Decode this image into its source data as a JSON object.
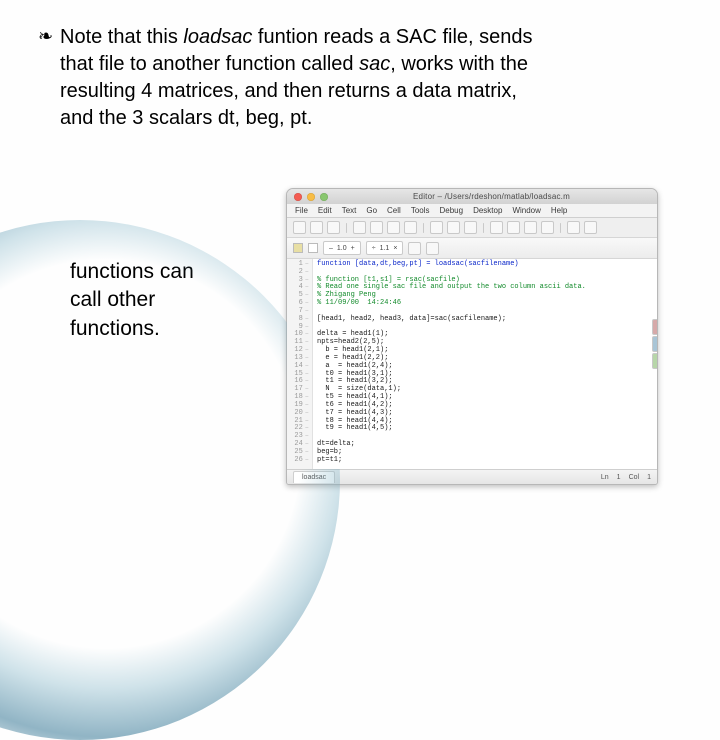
{
  "accent": "#3f7a93",
  "bullet": {
    "glyph": "❧",
    "line1_a": "Note that this ",
    "line1_i": "loadsac",
    "line1_b": " funtion reads a SAC file, sends ",
    "line2_a": "that file to another function called ",
    "line2_i": "sac",
    "line2_b": ", works with the ",
    "line3": "resulting 4 matrices, and then returns a data matrix, ",
    "line4": "and the 3 scalars dt, beg, pt."
  },
  "aside": {
    "l1": "functions can",
    "l2": "call other",
    "l3": "functions."
  },
  "editor": {
    "traffic": {
      "close": "#f45c52",
      "min": "#f8bd45",
      "max": "#89c76f"
    },
    "title": "Editor – /Users/rdeshon/matlab/loadsac.m",
    "menu": [
      "File",
      "Edit",
      "Text",
      "Go",
      "Cell",
      "Tools",
      "Debug",
      "Desktop",
      "Window",
      "Help"
    ],
    "tool2": {
      "pill1": "1.0",
      "pill2": "1.1"
    },
    "right_tab_colors": [
      "#d6a9a9",
      "#a9c5d6",
      "#b7d6a9"
    ],
    "gutter_count": 26,
    "code_lines": [
      {
        "t": "kw",
        "s": "function [data,dt,beg,pt] = loadsac(sacfilename)"
      },
      {
        "t": "",
        "s": ""
      },
      {
        "t": "cm",
        "s": "% function [t1,s1] = rsac(sacfile)"
      },
      {
        "t": "cm",
        "s": "% Read one single sac file and output the two column ascii data."
      },
      {
        "t": "cm",
        "s": "% Zhigang Peng"
      },
      {
        "t": "cm",
        "s": "% 11/09/00  14:24:46"
      },
      {
        "t": "",
        "s": ""
      },
      {
        "t": "",
        "s": "[head1, head2, head3, data]=sac(sacfilename);"
      },
      {
        "t": "",
        "s": ""
      },
      {
        "t": "",
        "s": "delta = head1(1);"
      },
      {
        "t": "",
        "s": "npts=head2(2,5);"
      },
      {
        "t": "",
        "s": "  b = head1(2,1);"
      },
      {
        "t": "",
        "s": "  e = head1(2,2);"
      },
      {
        "t": "",
        "s": "  a  = head1(2,4);"
      },
      {
        "t": "",
        "s": "  t0 = head1(3,1);"
      },
      {
        "t": "",
        "s": "  t1 = head1(3,2);"
      },
      {
        "t": "",
        "s": "  N  = size(data,1);"
      },
      {
        "t": "",
        "s": "  t5 = head1(4,1);"
      },
      {
        "t": "",
        "s": "  t6 = head1(4,2);"
      },
      {
        "t": "",
        "s": "  t7 = head1(4,3);"
      },
      {
        "t": "",
        "s": "  t8 = head1(4,4);"
      },
      {
        "t": "",
        "s": "  t9 = head1(4,5);"
      },
      {
        "t": "",
        "s": ""
      },
      {
        "t": "",
        "s": "dt=delta;"
      },
      {
        "t": "",
        "s": "beg=b;"
      },
      {
        "t": "",
        "s": "pt=t1;"
      }
    ],
    "status": {
      "tab": "loadsac",
      "ln_label": "Ln",
      "ln": "1",
      "col_label": "Col",
      "col": "1"
    }
  }
}
